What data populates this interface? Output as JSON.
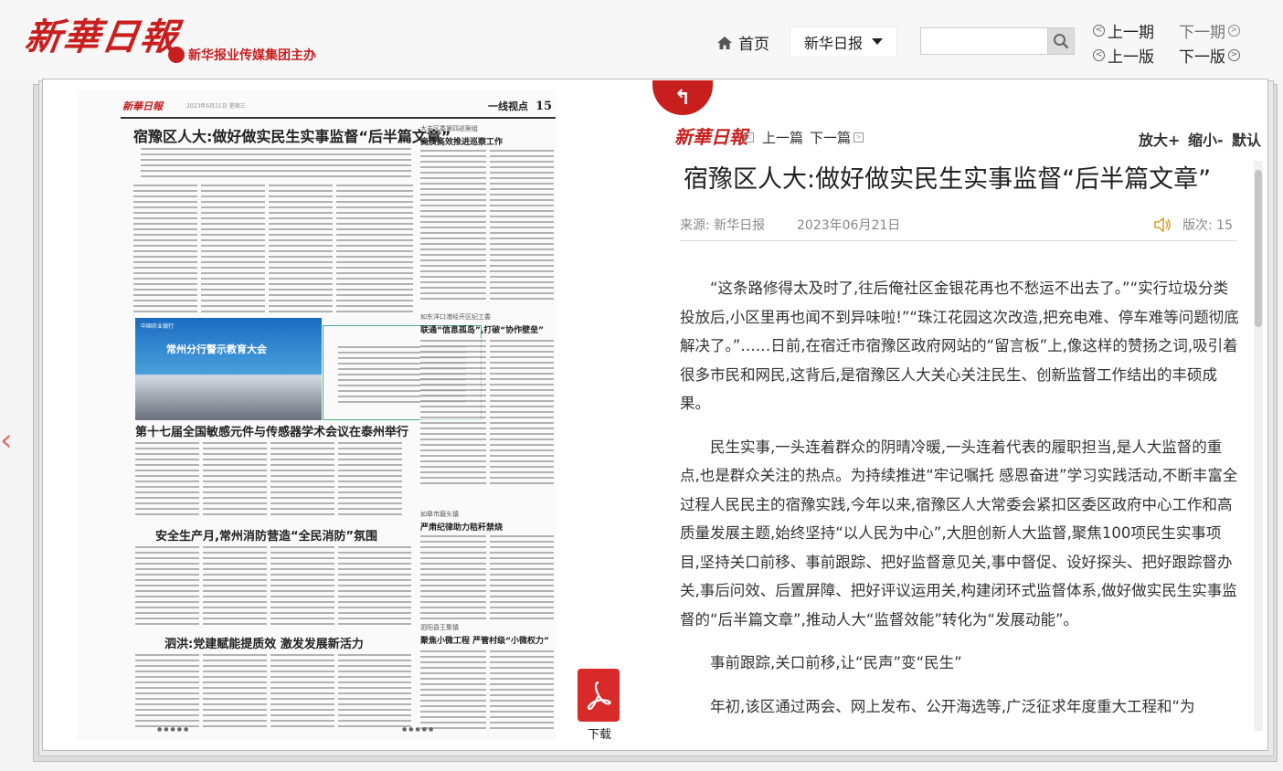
{
  "header": {
    "logo": "新華日報",
    "sublogo": "新华报业传媒集团主办",
    "home": "首页",
    "paper_select": "新华日报",
    "search_placeholder": "",
    "prev_article": "上一期",
    "next_article": "下一期",
    "prev_edition": "上一版",
    "next_edition": "下一版"
  },
  "newspaper": {
    "masthead": "新華日報",
    "date_line": "2023年6月21日  星期三",
    "section": "一线视点",
    "page_no": "15",
    "headline_main": "宿豫区人大:做好做实民生实事监督“后半篇文章”",
    "sub1_kicker": "大丰区委第四巡察组",
    "sub1_title": "高质高效推进巡察工作",
    "sub2_kicker": "如东洋口港经开区纪工委",
    "sub2_title": "联通“信息孤岛”,打破“协作壁垒”",
    "photo_caption": "常州分行警示教育大会",
    "photo_bank": "中国农业银行",
    "headline_2": "第十七届全国敏感元件与传感器学术会议在泰州举行",
    "sub3_kicker": "如皋市磨头镇",
    "sub3_title": "严肃纪律助力秸秆禁烧",
    "headline_3": "安全生产月,常州消防营造“全民消防”氛围",
    "sub4_kicker": "泗阳县王集镇",
    "sub4_title": "聚焦小微工程 严管村级“小微权力”",
    "headline_4": "泗洪:党建赋能提质效 激发发展新活力"
  },
  "download": {
    "label": "下载"
  },
  "article": {
    "masthead": "新華日報",
    "prev": "上一篇",
    "next": "下一篇",
    "zoom_in": "放大+",
    "zoom_out": "缩小-",
    "zoom_default": "默认",
    "title": "宿豫区人大:做好做实民生实事监督“后半篇文章”",
    "source": "来源: 新华日报",
    "date": "2023年06月21日",
    "edition": "版次: 15",
    "paragraphs": [
      "“这条路修得太及时了,往后俺社区金银花再也不愁运不出去了。”“实行垃圾分类投放后,小区里再也闻不到异味啦!”“珠江花园这次改造,把充电难、停车难等问题彻底解决了。”……日前,在宿迁市宿豫区政府网站的“留言板”上,像这样的赞扬之词,吸引着很多市民和网民,这背后,是宿豫区人大关心关注民生、创新监督工作结出的丰硕成果。",
      "民生实事,一头连着群众的阴晴冷暖,一头连着代表的履职担当,是人大监督的重点,也是群众关注的热点。为持续推进“牢记嘱托 感恩奋进”学习实践活动,不断丰富全过程人民民主的宿豫实践,今年以来,宿豫区人大常委会紧扣区委区政府中心工作和高质量发展主题,始终坚持“以人民为中心”,大胆创新人大监督,聚焦100项民生实事项目,坚持关口前移、事前跟踪、把好监督意见关,事中督促、设好探头、把好跟踪督办关,事后问效、后置屏障、把好评议运用关,构建闭环式监督体系,做好做实民生实事监督的“后半篇文章”,推动人大“监督效能”转化为“发展动能”。",
      "事前跟踪,关口前移,让“民声”变“民生”",
      "年初,该区通过两会、网上发布、公开海选等,广泛征求年度重大工程和“为"
    ]
  }
}
